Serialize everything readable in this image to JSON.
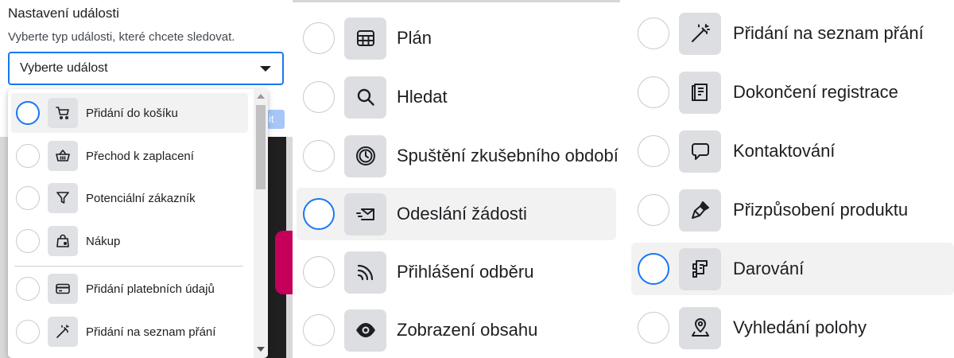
{
  "panel1": {
    "title": "Nastavení události",
    "subtitle": "Vyberte typ události, které chcete sledovat.",
    "select_value": "Vyberte událost",
    "button_fragment": "it",
    "items": [
      {
        "label": "Přidání do košíku",
        "icon": "cart-icon",
        "selected": true
      },
      {
        "label": "Přechod k zaplacení",
        "icon": "basket-icon",
        "selected": false
      },
      {
        "label": "Potenciální zákazník",
        "icon": "funnel-icon",
        "selected": false
      },
      {
        "label": "Nákup",
        "icon": "shopping-bag-icon",
        "selected": false
      },
      {
        "label": "Přidání platebních údajů",
        "icon": "credit-card-icon",
        "selected": false
      },
      {
        "label": "Přidání na seznam přání",
        "icon": "magic-wand-icon",
        "selected": false
      }
    ]
  },
  "panel2": {
    "items": [
      {
        "label": "Plán",
        "icon": "calendar-grid-icon",
        "selected": false
      },
      {
        "label": "Hledat",
        "icon": "search-icon",
        "selected": false
      },
      {
        "label": "Spuštění zkušebního období",
        "icon": "clock-icon",
        "selected": false
      },
      {
        "label": "Odeslání žádosti",
        "icon": "send-mail-icon",
        "selected": true
      },
      {
        "label": "Přihlášení odběru",
        "icon": "rss-icon",
        "selected": false
      },
      {
        "label": "Zobrazení obsahu",
        "icon": "eye-icon",
        "selected": false
      }
    ]
  },
  "panel3": {
    "items": [
      {
        "label": "Přidání na seznam přání",
        "icon": "magic-wand-icon",
        "selected": false
      },
      {
        "label": "Dokončení registrace",
        "icon": "registration-form-icon",
        "selected": false
      },
      {
        "label": "Kontaktování",
        "icon": "chat-bubble-icon",
        "selected": false
      },
      {
        "label": "Přizpůsobení produktu",
        "icon": "paint-brush-icon",
        "selected": false
      },
      {
        "label": "Darování",
        "icon": "donation-icon",
        "selected": true
      },
      {
        "label": "Vyhledání polohy",
        "icon": "location-pin-icon",
        "selected": false
      }
    ]
  },
  "colors": {
    "accent": "#1877f2",
    "icon_bg": "#dcdee1",
    "highlight_bg": "#f2f2f2",
    "radio_border": "#c8cacd"
  }
}
